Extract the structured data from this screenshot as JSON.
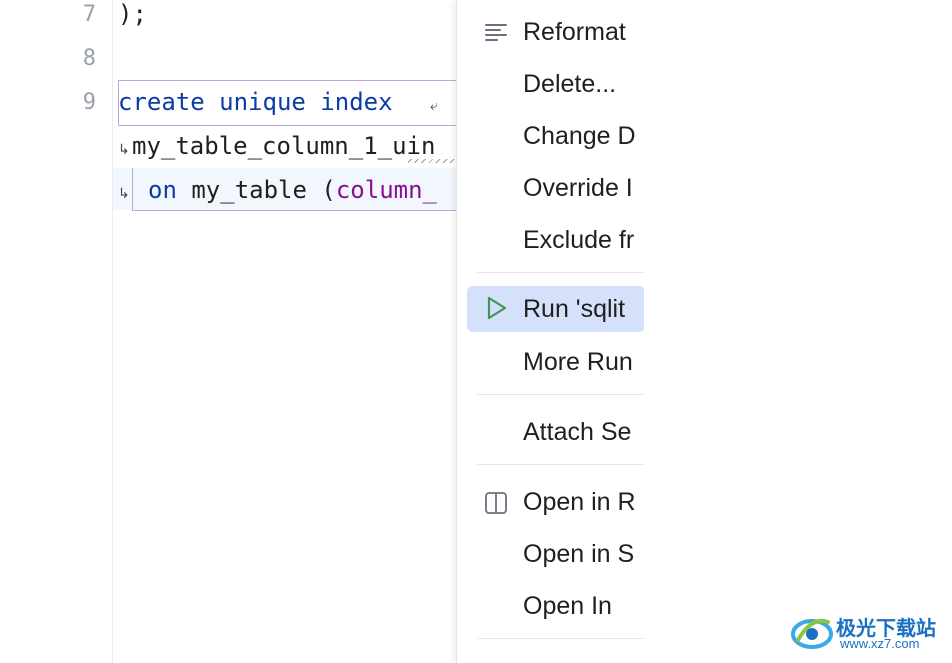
{
  "editor": {
    "line_numbers": [
      "7",
      "8",
      "9"
    ],
    "lines": {
      "l7": ");",
      "l9_kw": "create unique index",
      "l10": "my_table_column_1_uin",
      "l11_kw": "on",
      "l11_text": " my_table (",
      "l11_col": "column_"
    }
  },
  "context_menu": {
    "items": [
      {
        "label": "Reformat",
        "icon": "reformat-icon"
      },
      {
        "label": "Delete..."
      },
      {
        "label": "Change D"
      },
      {
        "label": "Override I"
      },
      {
        "label": "Exclude fr"
      },
      {
        "label": "Run 'sqlit",
        "icon": "run-icon",
        "highlighted": true,
        "accent": "#3d9a50"
      },
      {
        "label": "More Run"
      },
      {
        "label": "Attach Se"
      },
      {
        "label": "Open in R",
        "icon": "split-panel-icon"
      },
      {
        "label": "Open in S"
      },
      {
        "label": "Open In"
      }
    ]
  },
  "watermark": {
    "name": "极光下载站",
    "url": "www.xz7.com"
  },
  "colors": {
    "highlight": "#d5e1fb",
    "keyword": "#0b3ba5",
    "column": "#871094"
  }
}
